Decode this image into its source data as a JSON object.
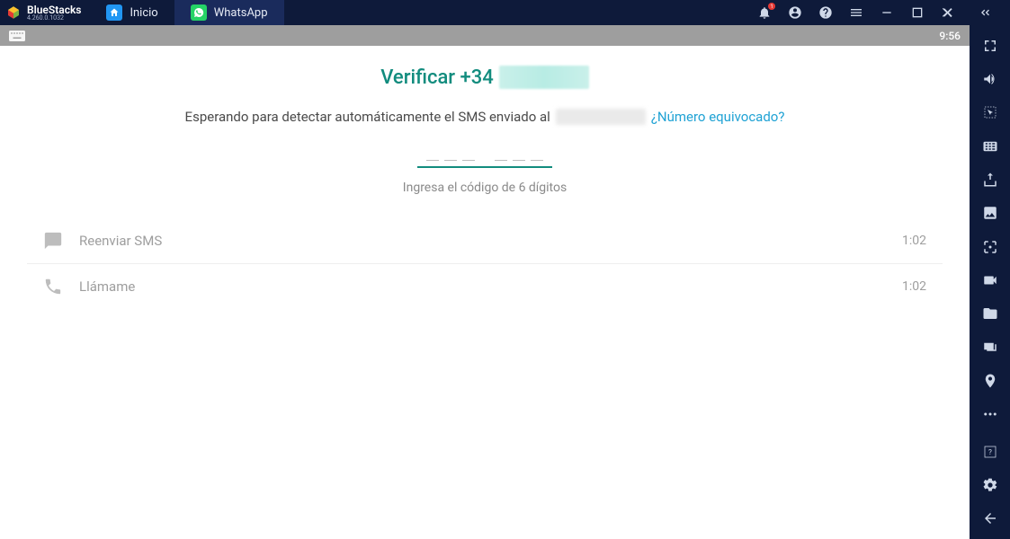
{
  "brand": {
    "name": "BlueStacks",
    "version": "4.260.0.1032"
  },
  "tabs": [
    {
      "label": "Inicio",
      "icon": "home"
    },
    {
      "label": "WhatsApp",
      "icon": "whatsapp",
      "active": true
    }
  ],
  "titleIcons": {
    "bell_badge": "1"
  },
  "statusBar": {
    "time": "9:56"
  },
  "verify": {
    "title_prefix": "Verificar +34",
    "sub_text": "Esperando para detectar automáticamente el SMS enviado al",
    "wrong_number": "¿Número equivocado?",
    "hint": "Ingresa el código de 6 dígitos"
  },
  "options": {
    "resend": {
      "label": "Reenviar SMS",
      "timer": "1:02"
    },
    "call": {
      "label": "Llámame",
      "timer": "1:02"
    }
  }
}
